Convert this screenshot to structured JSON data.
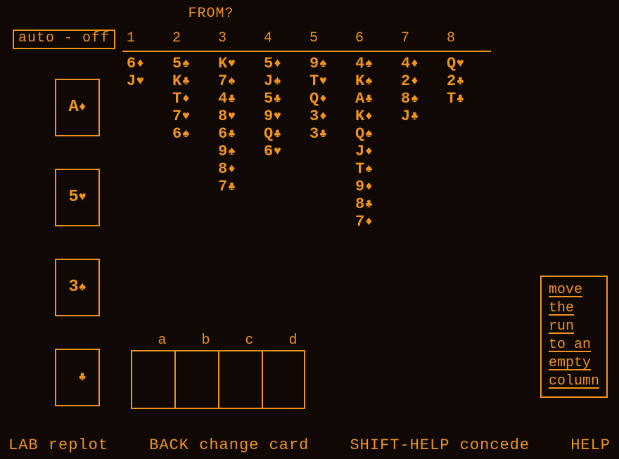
{
  "prompt": "FROM?",
  "auto_label": "auto - off",
  "column_numbers": [
    "1",
    "2",
    "3",
    "4",
    "5",
    "6",
    "7",
    "8"
  ],
  "columns": [
    [
      {
        "r": "6",
        "s": "♦"
      },
      {
        "r": "J",
        "s": "♥"
      }
    ],
    [
      {
        "r": "5",
        "s": "♠"
      },
      {
        "r": "K",
        "s": "♣"
      },
      {
        "r": "T",
        "s": "♦"
      },
      {
        "r": "7",
        "s": "♥"
      },
      {
        "r": "6",
        "s": "♠"
      }
    ],
    [
      {
        "r": "K",
        "s": "♥"
      },
      {
        "r": "7",
        "s": "♠"
      },
      {
        "r": "4",
        "s": "♣"
      },
      {
        "r": "8",
        "s": "♥"
      },
      {
        "r": "6",
        "s": "♣"
      },
      {
        "r": "9",
        "s": "♠"
      },
      {
        "r": "8",
        "s": "♦"
      },
      {
        "r": "7",
        "s": "♣"
      }
    ],
    [
      {
        "r": "5",
        "s": "♦"
      },
      {
        "r": "J",
        "s": "♠"
      },
      {
        "r": "5",
        "s": "♣"
      },
      {
        "r": "9",
        "s": "♥"
      },
      {
        "r": "Q",
        "s": "♣"
      },
      {
        "r": "6",
        "s": "♥"
      }
    ],
    [
      {
        "r": "9",
        "s": "♠"
      },
      {
        "r": "T",
        "s": "♥"
      },
      {
        "r": "Q",
        "s": "♦"
      },
      {
        "r": "3",
        "s": "♦"
      },
      {
        "r": "3",
        "s": "♣"
      }
    ],
    [
      {
        "r": "4",
        "s": "♠"
      },
      {
        "r": "K",
        "s": "♠"
      },
      {
        "r": "A",
        "s": "♣"
      },
      {
        "r": "K",
        "s": "♦"
      },
      {
        "r": "Q",
        "s": "♠"
      },
      {
        "r": "J",
        "s": "♦"
      },
      {
        "r": "T",
        "s": "♠"
      },
      {
        "r": "9",
        "s": "♦"
      },
      {
        "r": "8",
        "s": "♣"
      },
      {
        "r": "7",
        "s": "♦"
      }
    ],
    [
      {
        "r": "4",
        "s": "♦"
      },
      {
        "r": "2",
        "s": "♦"
      },
      {
        "r": "8",
        "s": "♠"
      },
      {
        "r": "J",
        "s": "♣"
      }
    ],
    [
      {
        "r": "Q",
        "s": "♥"
      },
      {
        "r": "2",
        "s": "♣"
      },
      {
        "r": "T",
        "s": "♣"
      }
    ]
  ],
  "piles": [
    {
      "r": "A",
      "s": "♦"
    },
    {
      "r": "5",
      "s": "♥"
    },
    {
      "r": "3",
      "s": "♠"
    },
    {
      "r": "",
      "s": "♣"
    }
  ],
  "free_labels": [
    "a",
    "b",
    "c",
    "d"
  ],
  "hint_lines": [
    "move",
    "the",
    "run",
    "to an",
    "empty",
    "column"
  ],
  "bottom": {
    "lab": "LAB replot",
    "back": "BACK change card",
    "shift": "SHIFT-HELP concede",
    "help": "HELP"
  }
}
